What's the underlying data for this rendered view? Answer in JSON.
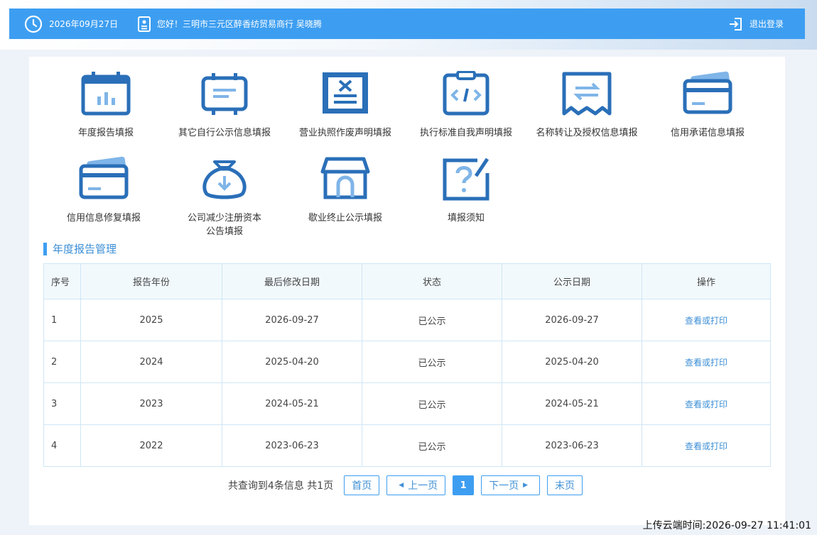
{
  "header": {
    "date": "2026年09月27日",
    "greeting": "您好！三明市三元区醉香纺贸易商行 吴晓腾",
    "logout": "退出登录"
  },
  "menu": [
    {
      "label": "年度报告填报",
      "icon": "calendar-chart-icon"
    },
    {
      "label": "其它自行公示信息填报",
      "icon": "document-lines-icon"
    },
    {
      "label": "营业执照作废声明填报",
      "icon": "license-void-icon"
    },
    {
      "label": "执行标准自我声明填报",
      "icon": "clipboard-code-icon"
    },
    {
      "label": "名称转让及授权信息填报",
      "icon": "transfer-arrows-icon"
    },
    {
      "label": "信用承诺信息填报",
      "icon": "credit-card-icon"
    },
    {
      "label": "信用信息修复填报",
      "icon": "credit-card-repair-icon"
    },
    {
      "label": "公司减少注册资本",
      "label2": "公告填报",
      "icon": "money-bag-icon"
    },
    {
      "label": "歇业终止公示填报",
      "icon": "store-icon"
    },
    {
      "label": "填报须知",
      "icon": "question-edit-icon"
    }
  ],
  "section_title": "年度报告管理",
  "table": {
    "headers": [
      "序号",
      "报告年份",
      "最后修改日期",
      "状态",
      "公示日期",
      "操作"
    ],
    "rows": [
      [
        "1",
        "2025",
        "2026-09-27",
        "已公示",
        "2026-09-27",
        "查看或打印"
      ],
      [
        "2",
        "2024",
        "2025-04-20",
        "已公示",
        "2025-04-20",
        "查看或打印"
      ],
      [
        "3",
        "2023",
        "2024-05-21",
        "已公示",
        "2024-05-21",
        "查看或打印"
      ],
      [
        "4",
        "2022",
        "2023-06-23",
        "已公示",
        "2023-06-23",
        "查看或打印"
      ]
    ]
  },
  "pager": {
    "summary": "共查询到4条信息 共1页",
    "first": "首页",
    "prev": "上一页",
    "current": "1",
    "next": "下一页",
    "last": "末页"
  },
  "footer": {
    "upload_time": "上传云端时间:2026-09-27 11:41:01"
  },
  "colors": {
    "primary": "#3d9ef1",
    "icon": "#2a6fb8",
    "icon_light": "#7fb5e8"
  }
}
